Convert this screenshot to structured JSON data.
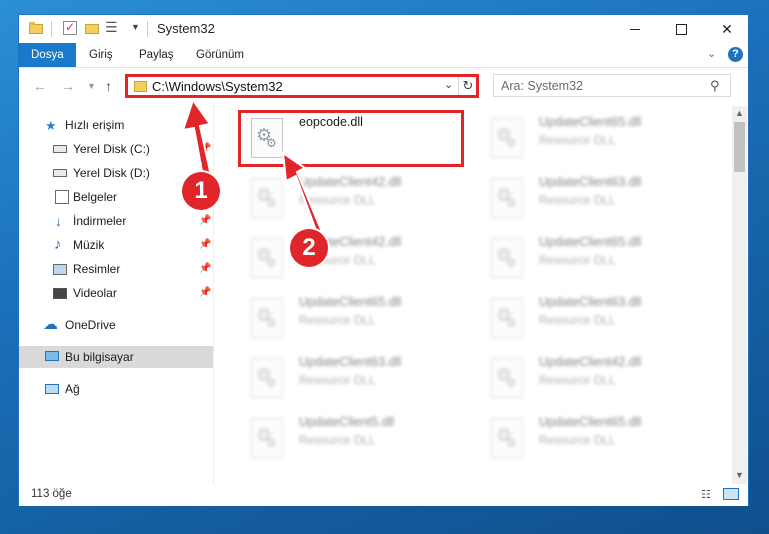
{
  "window": {
    "title": "System32",
    "controls": {
      "minimize": "",
      "maximize": "",
      "close": "✕"
    }
  },
  "ribbon": {
    "tabs": [
      "Dosya",
      "Giriş",
      "Paylaş",
      "Görünüm"
    ],
    "help": "?"
  },
  "address": {
    "path": "C:\\Windows\\System32",
    "search_placeholder": "Ara: System32"
  },
  "navpane": {
    "items": [
      {
        "label": "Hızlı erişim",
        "icon": "star-icon"
      },
      {
        "label": "Yerel Disk (C:)",
        "icon": "drive-icon"
      },
      {
        "label": "Yerel Disk (D:)",
        "icon": "drive-icon"
      },
      {
        "label": "Belgeler",
        "icon": "documents-icon"
      },
      {
        "label": "İndirmeler",
        "icon": "downloads-icon"
      },
      {
        "label": "Müzik",
        "icon": "music-icon"
      },
      {
        "label": "Resimler",
        "icon": "pictures-icon"
      },
      {
        "label": "Videolar",
        "icon": "videos-icon"
      },
      {
        "label": "OneDrive",
        "icon": "cloud-icon"
      },
      {
        "label": "Bu bilgisayar",
        "icon": "computer-icon"
      },
      {
        "label": "Ağ",
        "icon": "network-icon"
      }
    ]
  },
  "files": {
    "highlighted": {
      "name": "eopcode.dll",
      "type": ""
    },
    "items": [
      {
        "name": "UpdateClient65.dll",
        "type": "Resource DLL"
      },
      {
        "name": "UpdateClient42.dll",
        "type": "Resource DLL"
      },
      {
        "name": "UpdateClient63.dll",
        "type": "Resource DLL"
      },
      {
        "name": "UpdateClient42.dll",
        "type": "Resource DLL"
      },
      {
        "name": "UpdateClient65.dll",
        "type": "Resource DLL"
      },
      {
        "name": "UpdateClient65.dll",
        "type": "Resource DLL"
      },
      {
        "name": "UpdateClient63.dll",
        "type": "Resource DLL"
      },
      {
        "name": "UpdateClient63.dll",
        "type": "Resource DLL"
      },
      {
        "name": "UpdateClient42.dll",
        "type": "Resource DLL"
      },
      {
        "name": "UpdateClient5.dll",
        "type": "Resource DLL"
      },
      {
        "name": "UpdateClient65.dll",
        "type": "Resource DLL"
      }
    ]
  },
  "status": {
    "count": "113 öğe"
  },
  "annotations": {
    "step1": "1",
    "step2": "2",
    "color": "#e0262a"
  }
}
